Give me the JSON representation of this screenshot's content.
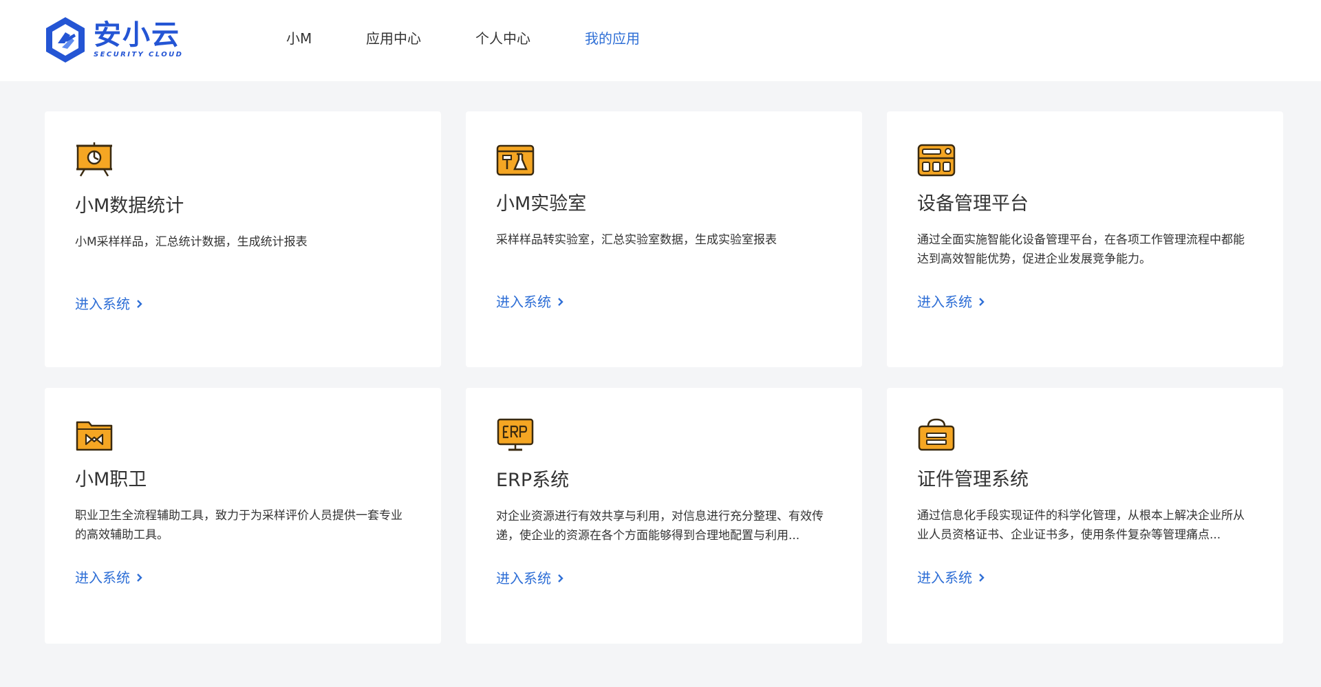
{
  "header": {
    "logo": {
      "name_cn": "安小云",
      "name_en": "SECURITY CLOUD"
    },
    "nav": [
      {
        "label": "小M",
        "active": false
      },
      {
        "label": "应用中心",
        "active": false
      },
      {
        "label": "个人中心",
        "active": false
      },
      {
        "label": "我的应用",
        "active": true
      }
    ]
  },
  "colors": {
    "brand_blue": "#2455d4",
    "link_blue": "#2f6fd6",
    "icon_orange": "#f5a623",
    "page_bg": "#f4f5f7"
  },
  "cards": [
    {
      "icon": "presentation-chart-icon",
      "title": "小M数据统计",
      "desc": "小M采样样品，汇总统计数据，生成统计报表",
      "link": "进入系统"
    },
    {
      "icon": "lab-flask-icon",
      "title": "小M实验室",
      "desc": "采样样品转实验室，汇总实验室数据，生成实验室报表",
      "link": "进入系统"
    },
    {
      "icon": "device-panel-icon",
      "title": "设备管理平台",
      "desc": "通过全面实施智能化设备管理平台，在各项工作管理流程中都能达到高效智能优势，促进企业发展竞争能力。",
      "link": "进入系统"
    },
    {
      "icon": "folder-icon",
      "title": "小M职卫",
      "desc": "职业卫生全流程辅助工具，致力于为采样评价人员提供一套专业的高效辅助工具。",
      "link": "进入系统"
    },
    {
      "icon": "erp-monitor-icon",
      "title": "ERP系统",
      "desc": "对企业资源进行有效共享与利用，对信息进行充分整理、有效传递，使企业的资源在各个方面能够得到合理地配置与利用...",
      "link": "进入系统"
    },
    {
      "icon": "certificate-box-icon",
      "title": "证件管理系统",
      "desc": "通过信息化手段实现证件的科学化管理，从根本上解决企业所从业人员资格证书、企业证书多，使用条件复杂等管理痛点...",
      "link": "进入系统"
    }
  ]
}
